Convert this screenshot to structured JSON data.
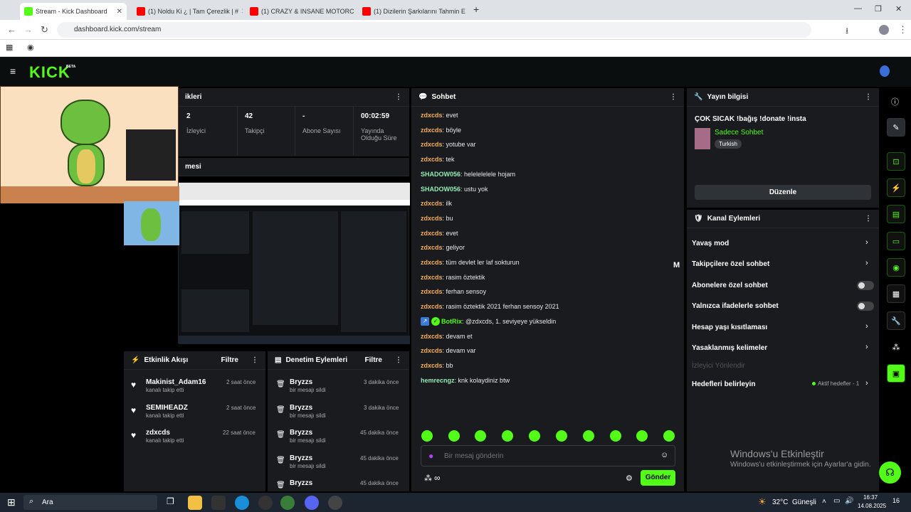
{
  "browser": {
    "tabs": [
      {
        "label": "Stream - Kick Dashboard",
        "active": true
      },
      {
        "label": "(1) Noldu Ki ¿ | Tam Çerezlik | #"
      },
      {
        "label": "(1) CRAZY & INSANE MOTORC"
      },
      {
        "label": "(1) Dizilerin Şarkılarını Tahmin E"
      }
    ],
    "new_tab": "+",
    "url": "dashboard.kick.com/stream"
  },
  "kick": {
    "logo": "KICK",
    "beta": "BETA"
  },
  "stats": {
    "title": "ikleri",
    "items": [
      {
        "value": "2",
        "label": "İzleyici"
      },
      {
        "value": "42",
        "label": "Takipçi"
      },
      {
        "value": "-",
        "label": "Abone Sayısı"
      },
      {
        "value": "00:02:59",
        "label": "Yayında Olduğu Süre"
      }
    ],
    "preview_title": "mesi"
  },
  "chat": {
    "title": "Sohbet",
    "messages": [
      {
        "user": "zdxcds",
        "text": "evet",
        "color": "#f7ae5a"
      },
      {
        "user": "zdxcds",
        "text": "böyle",
        "color": "#f7ae5a"
      },
      {
        "user": "zdxcds",
        "text": "yotube var",
        "color": "#f7ae5a"
      },
      {
        "user": "zdxcds",
        "text": "tek",
        "color": "#f7ae5a"
      },
      {
        "user": "SHADOW056",
        "text": "helelelelele hojam",
        "color": "#93ebb8"
      },
      {
        "user": "SHADOW056",
        "text": "ustu yok",
        "color": "#93ebb8"
      },
      {
        "user": "zdxcds",
        "text": "ilk",
        "color": "#f7ae5a"
      },
      {
        "user": "zdxcds",
        "text": "bu",
        "color": "#f7ae5a"
      },
      {
        "user": "zdxcds",
        "text": "evet",
        "color": "#f7ae5a"
      },
      {
        "user": "zdxcds",
        "text": "geliyor",
        "color": "#f7ae5a"
      },
      {
        "user": "zdxcds",
        "text": "tüm devlet ler laf sokturun",
        "color": "#f7ae5a"
      },
      {
        "user": "zdxcds",
        "text": "rasim öztektik",
        "color": "#f7ae5a"
      },
      {
        "user": "zdxcds",
        "text": "ferhan sensoy",
        "color": "#f7ae5a"
      },
      {
        "user": "zdxcds",
        "text": "rasim öztektik 2021 ferhan sensoy 2021",
        "color": "#f7ae5a"
      },
      {
        "user": "BotRix",
        "text": "@zdxcds, 1. seviyeye yükseldin",
        "color": "#53fc18"
      },
      {
        "user": "zdxcds",
        "text": "devam et",
        "color": "#f7ae5a"
      },
      {
        "user": "zdxcds",
        "text": "devam var",
        "color": "#f7ae5a"
      },
      {
        "user": "zdxcds",
        "text": "bb",
        "color": "#f7ae5a"
      },
      {
        "user": "hemrecngz",
        "text": "knk kolaydiniz btw",
        "color": "#93ebb8"
      }
    ],
    "input_placeholder": "Bir mesaj gönderin",
    "send_label": "Gönder",
    "side_letter": "M"
  },
  "stream_info": {
    "title": "Yayın bilgisi",
    "stream_title": "ÇOK SICAK !bağış !donate !insta",
    "category": "Sadece Sohbet",
    "tag": "Turkish",
    "edit_label": "Düzenle"
  },
  "channel_actions": {
    "title": "Kanal Eylemleri",
    "items": [
      {
        "label": "Yavaş mod",
        "control": "chevron"
      },
      {
        "label": "Takipçilere özel sohbet",
        "control": "chevron"
      },
      {
        "label": "Abonelere özel sohbet",
        "control": "toggle"
      },
      {
        "label": "Yalnızca ifadelerle sohbet",
        "control": "toggle"
      },
      {
        "label": "Hesap yaşı kısıtlaması",
        "control": "chevron"
      },
      {
        "label": "Yasaklanmış kelimeler",
        "control": "chevron"
      },
      {
        "label": "İzleyici Yönlendir",
        "control": "none"
      },
      {
        "label": "Hedefleri belirleyin",
        "control": "chevron",
        "badge": "Aktif hedefler - 1"
      }
    ]
  },
  "activity": {
    "title": "Etkinlik Akışı",
    "filter": "Filtre",
    "items": [
      {
        "user": "Makinist_Adam16",
        "desc": "kanalı takip etti",
        "time": "2 saat önce"
      },
      {
        "user": "SEMIHEADZ",
        "desc": "kanalı takip etti",
        "time": "2 saat önce"
      },
      {
        "user": "zdxcds",
        "desc": "kanalı takip etti",
        "time": "22 saat önce"
      }
    ]
  },
  "moderation": {
    "title": "Denetim Eylemleri",
    "filter": "Filtre",
    "items": [
      {
        "user": "Bryzzs",
        "desc": "bir mesajı sildi",
        "time": "3 dakika önce"
      },
      {
        "user": "Bryzzs",
        "desc": "bir mesajı sildi",
        "time": "3 dakika önce"
      },
      {
        "user": "Bryzzs",
        "desc": "bir mesajı sildi",
        "time": "45 dakika önce"
      },
      {
        "user": "Bryzzs",
        "desc": "bir mesajı sildi",
        "time": "45 dakika önce"
      },
      {
        "user": "Bryzzs",
        "desc": "",
        "time": "45 dakika önce"
      }
    ]
  },
  "windows": {
    "activate_title": "Windows'u Etkinleştir",
    "activate_sub": "Windows'u etkinleştirmek için Ayarlar'a gidin.",
    "search": "Ara",
    "weather": "32°C",
    "weather_desc": "Güneşli",
    "time": "16:37",
    "date": "14.08.2025",
    "notif": "16"
  },
  "colors": {
    "kick_green": "#53fc18",
    "panel": "#191b1f"
  }
}
